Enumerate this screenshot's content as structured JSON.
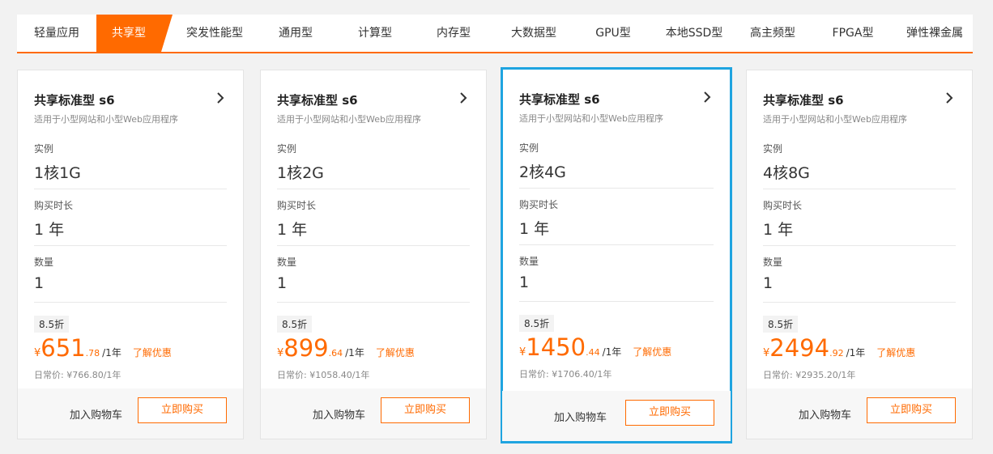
{
  "tabs": [
    {
      "label": "轻量应用",
      "active": false
    },
    {
      "label": "共享型",
      "active": true
    },
    {
      "label": "突发性能型",
      "active": false
    },
    {
      "label": "通用型",
      "active": false
    },
    {
      "label": "计算型",
      "active": false
    },
    {
      "label": "内存型",
      "active": false
    },
    {
      "label": "大数据型",
      "active": false
    },
    {
      "label": "GPU型",
      "active": false
    },
    {
      "label": "本地SSD型",
      "active": false
    },
    {
      "label": "高主频型",
      "active": false
    },
    {
      "label": "FPGA型",
      "active": false
    },
    {
      "label": "弹性裸金属",
      "active": false
    }
  ],
  "colors": {
    "accent": "#ff6a00",
    "highlight_border": "#1fa4e0"
  },
  "labels": {
    "instance": "实例",
    "duration": "购买时长",
    "quantity": "数量",
    "add_cart": "加入购物车",
    "buy_now": "立即购买",
    "promo": "了解优惠",
    "per_year": "/1年",
    "yen": "¥"
  },
  "cards": [
    {
      "title": "共享标准型 s6",
      "subtitle": "适用于小型网站和小型Web应用程序",
      "instance": "1核1G",
      "duration": "1 年",
      "quantity": "1",
      "discount": "8.5折",
      "price_int": "651",
      "price_dec": ".78",
      "orig_price": "日常价: ¥766.80/1年",
      "highlighted": false
    },
    {
      "title": "共享标准型 s6",
      "subtitle": "适用于小型网站和小型Web应用程序",
      "instance": "1核2G",
      "duration": "1 年",
      "quantity": "1",
      "discount": "8.5折",
      "price_int": "899",
      "price_dec": ".64",
      "orig_price": "日常价: ¥1058.40/1年",
      "highlighted": false
    },
    {
      "title": "共享标准型 s6",
      "subtitle": "适用于小型网站和小型Web应用程序",
      "instance": "2核4G",
      "duration": "1 年",
      "quantity": "1",
      "discount": "8.5折",
      "price_int": "1450",
      "price_dec": ".44",
      "orig_price": "日常价: ¥1706.40/1年",
      "highlighted": true
    },
    {
      "title": "共享标准型 s6",
      "subtitle": "适用于小型网站和小型Web应用程序",
      "instance": "4核8G",
      "duration": "1 年",
      "quantity": "1",
      "discount": "8.5折",
      "price_int": "2494",
      "price_dec": ".92",
      "orig_price": "日常价: ¥2935.20/1年",
      "highlighted": false
    }
  ]
}
